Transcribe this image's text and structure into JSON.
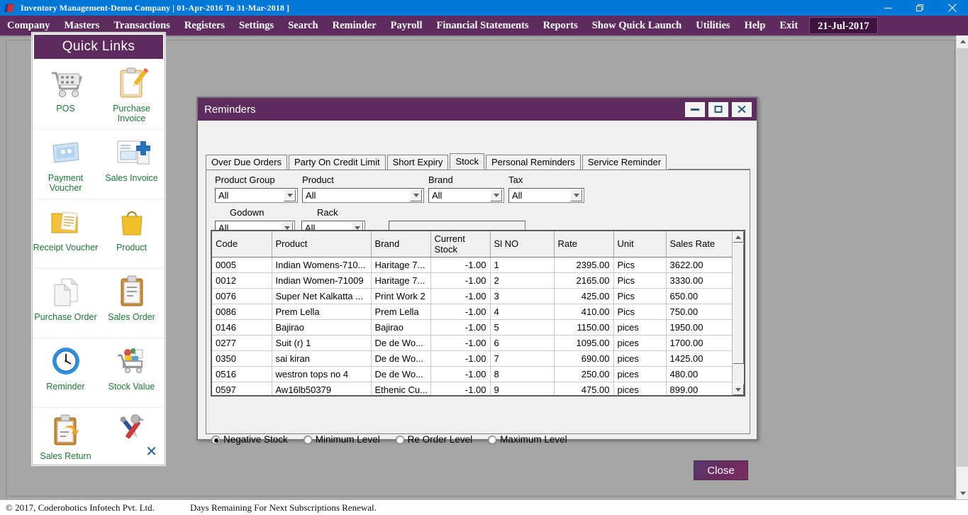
{
  "titlebar": {
    "title": "Inventory Management-Demo Company | 01-Apr-2016 To 31-Mar-2018 ]",
    "minimize": "minimize-icon",
    "restore": "restore-icon",
    "close": "close-icon",
    "accent": "#0078d7"
  },
  "menubar": {
    "accent": "#5d2b5d",
    "items": [
      "Company",
      "Masters",
      "Transactions",
      "Registers",
      "Settings",
      "Search",
      "Reminder",
      "Payroll",
      "Financial Statements",
      "Reports",
      "Show Quick Launch",
      "Utilities",
      "Help",
      "Exit"
    ],
    "date": "21-Jul-2017"
  },
  "quicklinks": {
    "title": "Quick Links",
    "label_color": "#1a7a33",
    "close_icon": "close-icon",
    "items": [
      {
        "label": "POS",
        "icon": "shopping-cart-icon"
      },
      {
        "label": "Purchase Invoice",
        "icon": "clipboard-pencil-icon"
      },
      {
        "label": "Payment Voucher",
        "icon": "payment-card-icon"
      },
      {
        "label": "Sales Invoice",
        "icon": "invoice-plus-icon"
      },
      {
        "label": "Receipt Voucher",
        "icon": "folder-document-icon"
      },
      {
        "label": "Product",
        "icon": "shopping-bag-icon"
      },
      {
        "label": "Purchase Order",
        "icon": "documents-icon"
      },
      {
        "label": "Sales Order",
        "icon": "clipboard-lines-icon"
      },
      {
        "label": "Reminder",
        "icon": "clock-icon"
      },
      {
        "label": "Stock Value",
        "icon": "full-cart-icon"
      },
      {
        "label": "Sales Return",
        "icon": "clipboard-return-arrow-icon"
      },
      {
        "label": "",
        "icon": "tools-wrench-screwdriver-icon"
      }
    ]
  },
  "dialog": {
    "title": "Reminders",
    "accent": "#5d2b5d",
    "controls": {
      "minimize": "minimize-icon",
      "maximize": "maximize-icon",
      "close": "close-icon"
    },
    "tabs": [
      {
        "label": "Over Due Orders",
        "active": false
      },
      {
        "label": "Party On Credit Limit",
        "active": false
      },
      {
        "label": "Short Expiry",
        "active": false
      },
      {
        "label": "Stock",
        "active": true
      },
      {
        "label": "Personal Reminders",
        "active": false
      },
      {
        "label": "Service Reminder",
        "active": false
      }
    ],
    "filters": [
      {
        "label": "Product Group",
        "value": "All"
      },
      {
        "label": "Product",
        "value": "All"
      },
      {
        "label": "Brand",
        "value": "All"
      },
      {
        "label": "Tax",
        "value": "All"
      },
      {
        "label": "Godown",
        "value": "All"
      },
      {
        "label": "Rack",
        "value": "All"
      }
    ],
    "search_value": "",
    "grid": {
      "columns": [
        "Code",
        "Product",
        "Brand",
        "Current Stock",
        "Sl NO",
        "Rate",
        "Unit",
        "Sales Rate"
      ],
      "rows": [
        {
          "code": "0005",
          "product": "Indian Womens-710...",
          "brand": "Haritage 7...",
          "current_stock": "-1.00",
          "sl_no": "1",
          "rate": "2395.00",
          "unit": "Pics",
          "sales_rate": "3622.00"
        },
        {
          "code": "0012",
          "product": "Indian Women-71009",
          "brand": "Haritage 7...",
          "current_stock": "-1.00",
          "sl_no": "2",
          "rate": "2165.00",
          "unit": "Pics",
          "sales_rate": "3330.00"
        },
        {
          "code": "0076",
          "product": "Super Net Kalkatta ...",
          "brand": "Print Work 2",
          "current_stock": "-1.00",
          "sl_no": "3",
          "rate": "425.00",
          "unit": "Pics",
          "sales_rate": "650.00"
        },
        {
          "code": "0086",
          "product": "Prem Lella",
          "brand": "Prem Lella",
          "current_stock": "-1.00",
          "sl_no": "4",
          "rate": "410.00",
          "unit": "Pics",
          "sales_rate": "750.00"
        },
        {
          "code": "0146",
          "product": "Bajirao",
          "brand": "Bajirao",
          "current_stock": "-1.00",
          "sl_no": "5",
          "rate": "1150.00",
          "unit": "pices",
          "sales_rate": "1950.00"
        },
        {
          "code": "0277",
          "product": "Suit (r) 1",
          "brand": "De de Wo...",
          "current_stock": "-1.00",
          "sl_no": "6",
          "rate": "1095.00",
          "unit": "pices",
          "sales_rate": "1700.00"
        },
        {
          "code": "0350",
          "product": "sai kiran",
          "brand": "De de Wo...",
          "current_stock": "-1.00",
          "sl_no": "7",
          "rate": "690.00",
          "unit": "pices",
          "sales_rate": "1425.00"
        },
        {
          "code": "0516",
          "product": "westron tops no 4",
          "brand": "De de Wo...",
          "current_stock": "-1.00",
          "sl_no": "8",
          "rate": "250.00",
          "unit": "pices",
          "sales_rate": "480.00"
        },
        {
          "code": "0597",
          "product": "Aw16lb50379",
          "brand": "Ethenic Cu...",
          "current_stock": "-1.00",
          "sl_no": "9",
          "rate": "475.00",
          "unit": "pices",
          "sales_rate": "899.00"
        }
      ]
    },
    "radios": [
      {
        "label": "Negative Stock",
        "selected": true
      },
      {
        "label": "Minimum Level",
        "selected": false
      },
      {
        "label": "Re Order Level",
        "selected": false
      },
      {
        "label": "Maximum Level",
        "selected": false
      }
    ],
    "close_button": "Close"
  },
  "statusbar": {
    "copyright": "© 2017, Coderobotics Infotech Pvt. Ltd.",
    "subscription": "Days Remaining For Next Subscriptions Renewal."
  }
}
